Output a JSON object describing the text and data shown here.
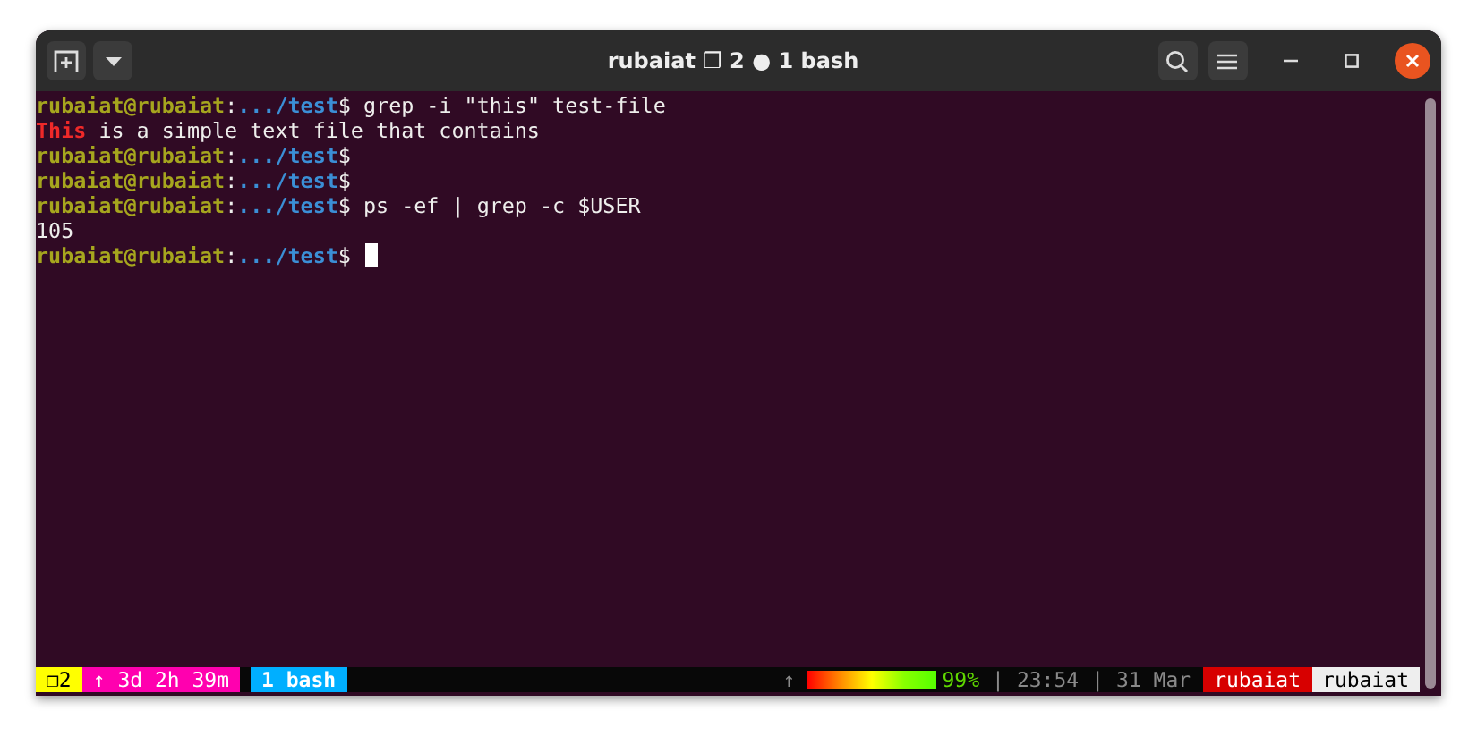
{
  "window": {
    "title": "rubaiat ❐ 2 ● 1 bash"
  },
  "terminal_lines": [
    {
      "kind": "prompt",
      "user": "rubaiat@rubaiat",
      "sep": ":",
      "path": ".../test",
      "symbol": "$",
      "command": " grep -i \"this\" test-file",
      "cursor": false
    },
    {
      "kind": "output",
      "match": "This",
      "text": " is a simple text file that contains"
    },
    {
      "kind": "prompt",
      "user": "rubaiat@rubaiat",
      "sep": ":",
      "path": ".../test",
      "symbol": "$",
      "cursor": false
    },
    {
      "kind": "prompt",
      "user": "rubaiat@rubaiat",
      "sep": ":",
      "path": ".../test",
      "symbol": "$",
      "cursor": false
    },
    {
      "kind": "prompt",
      "user": "rubaiat@rubaiat",
      "sep": ":",
      "path": ".../test",
      "symbol": "$",
      "command": " ps -ef | grep -c $USER",
      "cursor": false
    },
    {
      "kind": "output",
      "text": "105"
    },
    {
      "kind": "prompt",
      "user": "rubaiat@rubaiat",
      "sep": ":",
      "path": ".../test",
      "symbol": "$",
      "cursor": true
    }
  ],
  "status_bar": {
    "left": [
      {
        "text": "❐2",
        "color": "#ffff00"
      },
      {
        "text": "↑ 3d 2h 39m",
        "color": "#ff00af"
      },
      {
        "text": "1 bash",
        "color": "#00afff"
      }
    ],
    "arrow": "↑",
    "battery": {
      "level": 0.99,
      "reading": "99%"
    },
    "info": [
      {
        "text": "|"
      },
      {
        "text": "23:54"
      },
      {
        "text": "|"
      },
      {
        "text": "31 Mar"
      }
    ],
    "right": [
      {
        "text": "rubaiat",
        "color": "#d70000"
      },
      {
        "text": "rubaiat",
        "color": "#eeeeee"
      }
    ]
  }
}
